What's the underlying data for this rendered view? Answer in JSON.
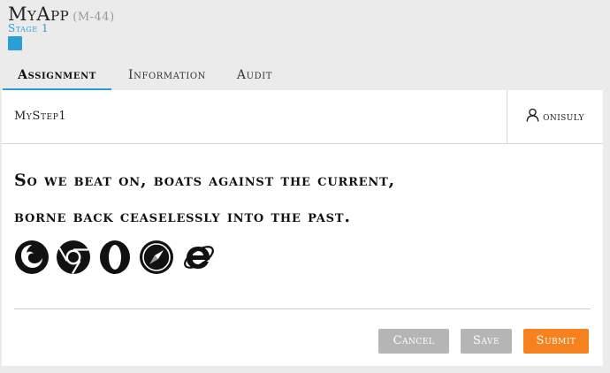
{
  "app": {
    "name": "MyApp",
    "code": "(M-44)",
    "stage": "Stage 1",
    "stage_color": "#2a9fd6"
  },
  "tabs": [
    {
      "label": "Assignment",
      "active": true
    },
    {
      "label": "Information",
      "active": false
    },
    {
      "label": "Audit",
      "active": false
    }
  ],
  "step": {
    "name": "MyStep1",
    "assignee": "onisuly",
    "assignee_icon": "user-icon"
  },
  "content": {
    "quote_line1": "So we beat on, boats against the current,",
    "quote_line2": "borne back ceaselessly into the past.",
    "icons": [
      "firefox-icon",
      "chrome-icon",
      "opera-icon",
      "safari-icon",
      "internet-explorer-icon"
    ]
  },
  "actions": {
    "cancel": "Cancel",
    "save": "Save",
    "submit": "Submit",
    "submit_color": "#f5821f",
    "disabled_color": "#b5b5b5"
  }
}
